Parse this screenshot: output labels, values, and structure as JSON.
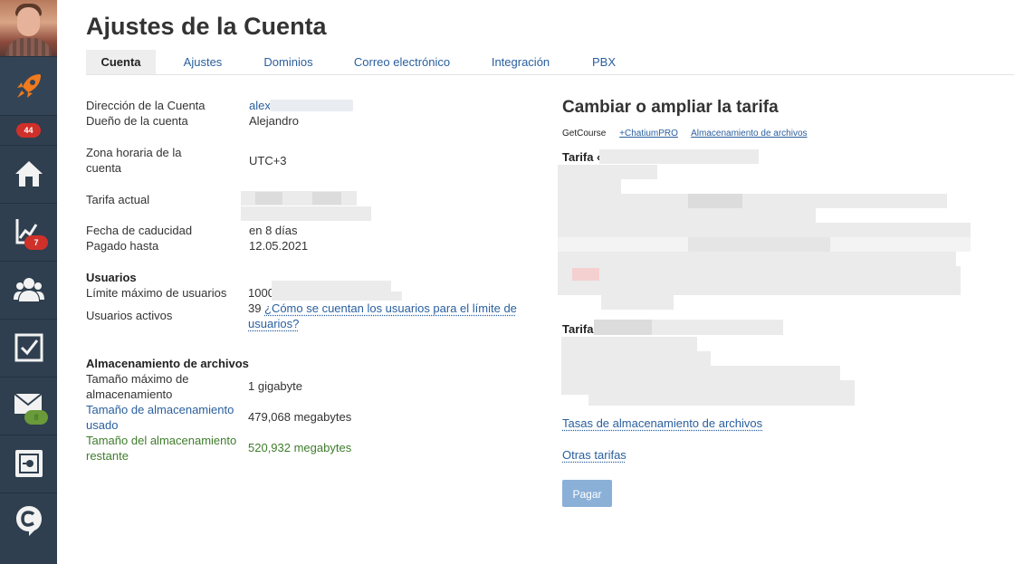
{
  "page": {
    "title": "Ajustes de la Cuenta"
  },
  "tabs": [
    {
      "label": "Cuenta"
    },
    {
      "label": "Ajustes"
    },
    {
      "label": "Dominios"
    },
    {
      "label": "Correo electrónico"
    },
    {
      "label": "Integración"
    },
    {
      "label": "PBX"
    }
  ],
  "sidebar": {
    "badges": {
      "rocket": "44",
      "stats": "7",
      "mail": "8"
    },
    "icons": [
      "rocket-icon",
      "home-icon",
      "chart-icon",
      "users-icon",
      "tasks-icon",
      "mail-icon",
      "safe-icon",
      "chat-icon"
    ]
  },
  "account": {
    "address_label": "Dirección de la Cuenta",
    "address_value": "alex",
    "owner_label": "Dueño de la cuenta",
    "owner_value": "Alejandro",
    "timezone_label_1": "Zona horaria de la",
    "timezone_label_2": "cuenta",
    "timezone_value": "UTC+3",
    "tariff_label": "Tarifa actual",
    "expiry_label": "Fecha de caducidad",
    "expiry_value": "en 8 días",
    "paid_label": "Pagado hasta",
    "paid_value": "12.05.2021"
  },
  "users": {
    "header": "Usuarios",
    "max_label": "Límite máximo de usuarios",
    "max_value": "1000",
    "active_label": "Usuarios activos",
    "active_value": "39",
    "help_link_1": "¿Cómo se cuentan los usuarios para el límite de",
    "help_link_2": "usuarios?"
  },
  "storage": {
    "header": "Almacenamiento de archivos",
    "max_label_1": "Tamaño máximo de",
    "max_label_2": "almacenamiento",
    "max_value": "1 gigabyte",
    "used_label_1": "Tamaño de almacenamiento",
    "used_label_2": "usado",
    "used_value": "479,068 megabytes",
    "remaining_label_1": "Tamaño del almacenamiento",
    "remaining_label_2": "restante",
    "remaining_value": "520,932 megabytes"
  },
  "tariffs": {
    "title": "Cambiar o ampliar la tarifa",
    "product_links": [
      "GetCourse",
      "+ChatiumPRO",
      "Almacenamiento de archivos"
    ],
    "tariff1_label": "Tarifa «",
    "tariff2_label": "Tarifa",
    "storage_rates_link": "Tasas de almacenamiento de archivos",
    "other_tariffs_link": "Otras tarifas",
    "pay_button": "Pagar"
  },
  "colors": {
    "sidebar": "#2f3f4f",
    "link": "#2a5f9e",
    "green_text": "#3f7d2c",
    "badge_red": "#d0302a",
    "badge_green": "#6a9a3a",
    "pay_button": "#8ab0d8"
  }
}
